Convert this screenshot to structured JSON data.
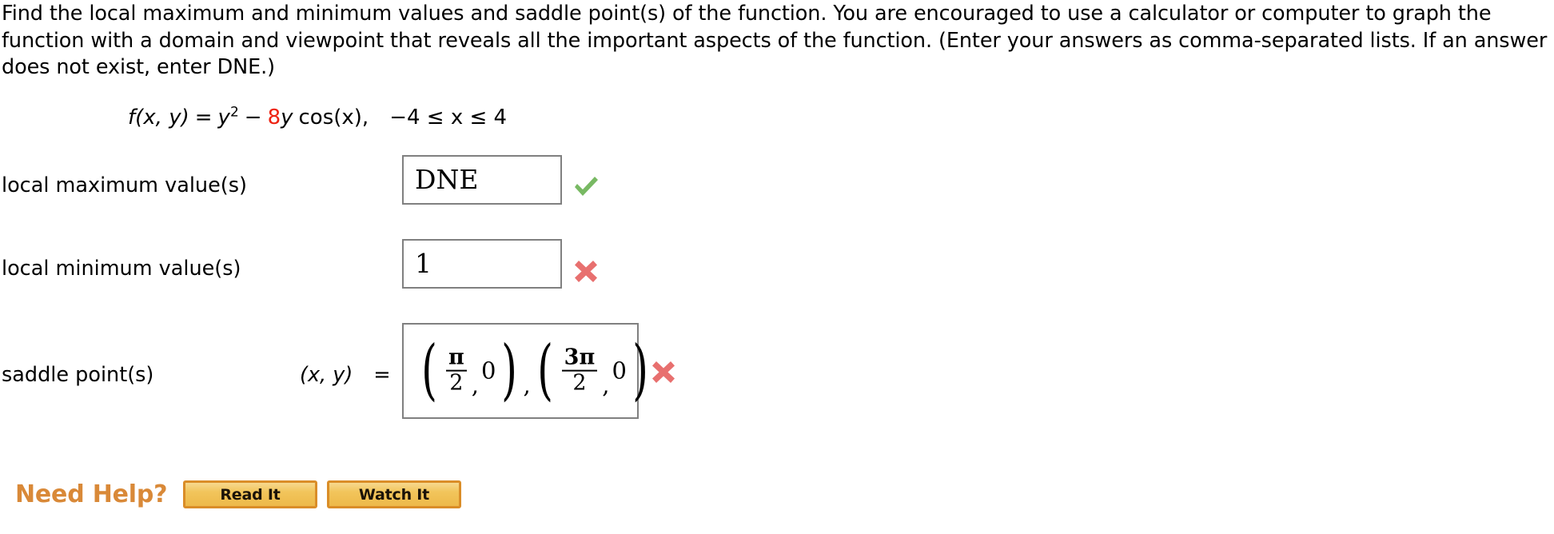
{
  "prompt": {
    "text": "Find the local maximum and minimum values and saddle point(s) of the function. You are encouraged to use a calculator or computer to graph the function with a domain and viewpoint that reveals all the important aspects of the function. (Enter your answers as comma-separated lists. If an answer does not exist, enter DNE.)"
  },
  "equation": {
    "lhs": "f(x, y)",
    "equals": "=",
    "term_y_squared_base": "y",
    "term_y_squared_exp": "2",
    "minus": "−",
    "coefficient": "8",
    "coefficient_color": "#ee2211",
    "term_y": "y",
    "cos_term": "cos(x)",
    "comma": ",",
    "domain": "−4 ≤ x ≤ 4"
  },
  "rows": [
    {
      "label": "local maximum value(s)",
      "value": "DNE",
      "status": "correct",
      "status_icon": "green-check-icon"
    },
    {
      "label": "local minimum value(s)",
      "value": "1",
      "status": "incorrect",
      "status_icon": "red-x-icon"
    },
    {
      "label": "saddle point(s)",
      "coordinate_label": "(x, y)",
      "equals": "=",
      "value": "(π/2, 0),(3π/2, 0)",
      "math": {
        "point1": {
          "x_num": "π",
          "x_den": "2",
          "y": "0"
        },
        "separator": ",",
        "point2": {
          "x_num": "3π",
          "x_den": "2",
          "y": "0"
        }
      },
      "status": "incorrect",
      "status_icon": "red-x-icon"
    }
  ],
  "help": {
    "heading": "Need Help?",
    "heading_color": "#d98938",
    "read_label": "Read It",
    "watch_label": "Watch It"
  },
  "colors": {
    "correct": "#78b963",
    "incorrect": "#e8706f",
    "input_border": "#808080",
    "accent_orange": "#d98938"
  }
}
